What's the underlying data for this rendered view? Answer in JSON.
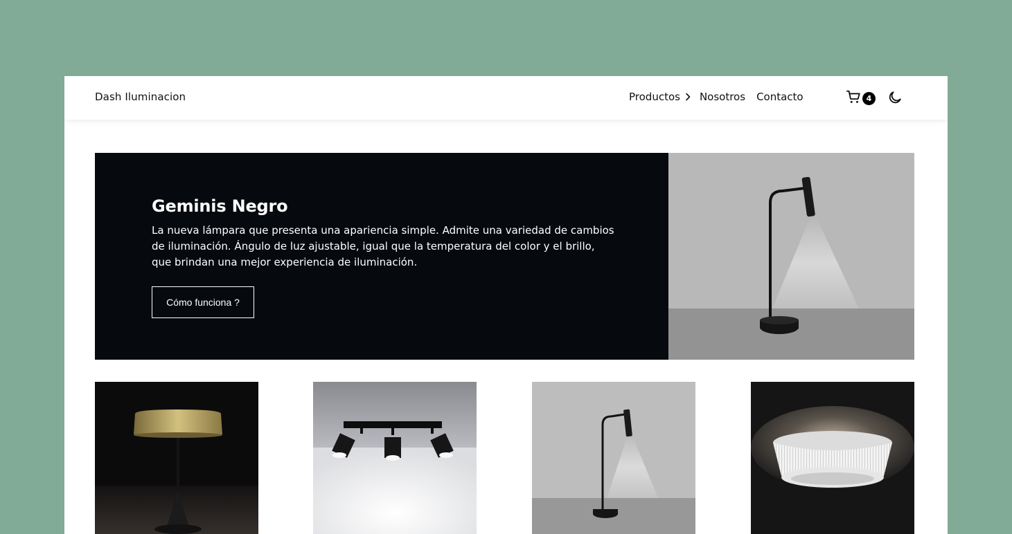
{
  "brand": "Dash Iluminacion",
  "nav": {
    "products": "Productos",
    "about": "Nosotros",
    "contact": "Contacto"
  },
  "cart": {
    "count": "4",
    "icon": "shopping-cart-icon"
  },
  "theme_icon": "moon-icon",
  "hero": {
    "title": "Geminis Negro",
    "description": "La nueva lámpara que presenta una apariencia simple. Admite una variedad de cambios de iluminación. Ángulo de luz ajustable, igual que la temperatura del color y el brillo, que brindan una mejor experiencia de iluminación.",
    "button": "Cómo funciona ?"
  },
  "products": [
    {
      "name": "brass-table-lamp"
    },
    {
      "name": "triple-ceiling-spotlight"
    },
    {
      "name": "geminis-desk-lamp"
    },
    {
      "name": "pleated-ceiling-lamp"
    }
  ],
  "colors": {
    "page_bg": "#81ab96",
    "hero_bg": "#060a0f",
    "text": "#111111"
  }
}
